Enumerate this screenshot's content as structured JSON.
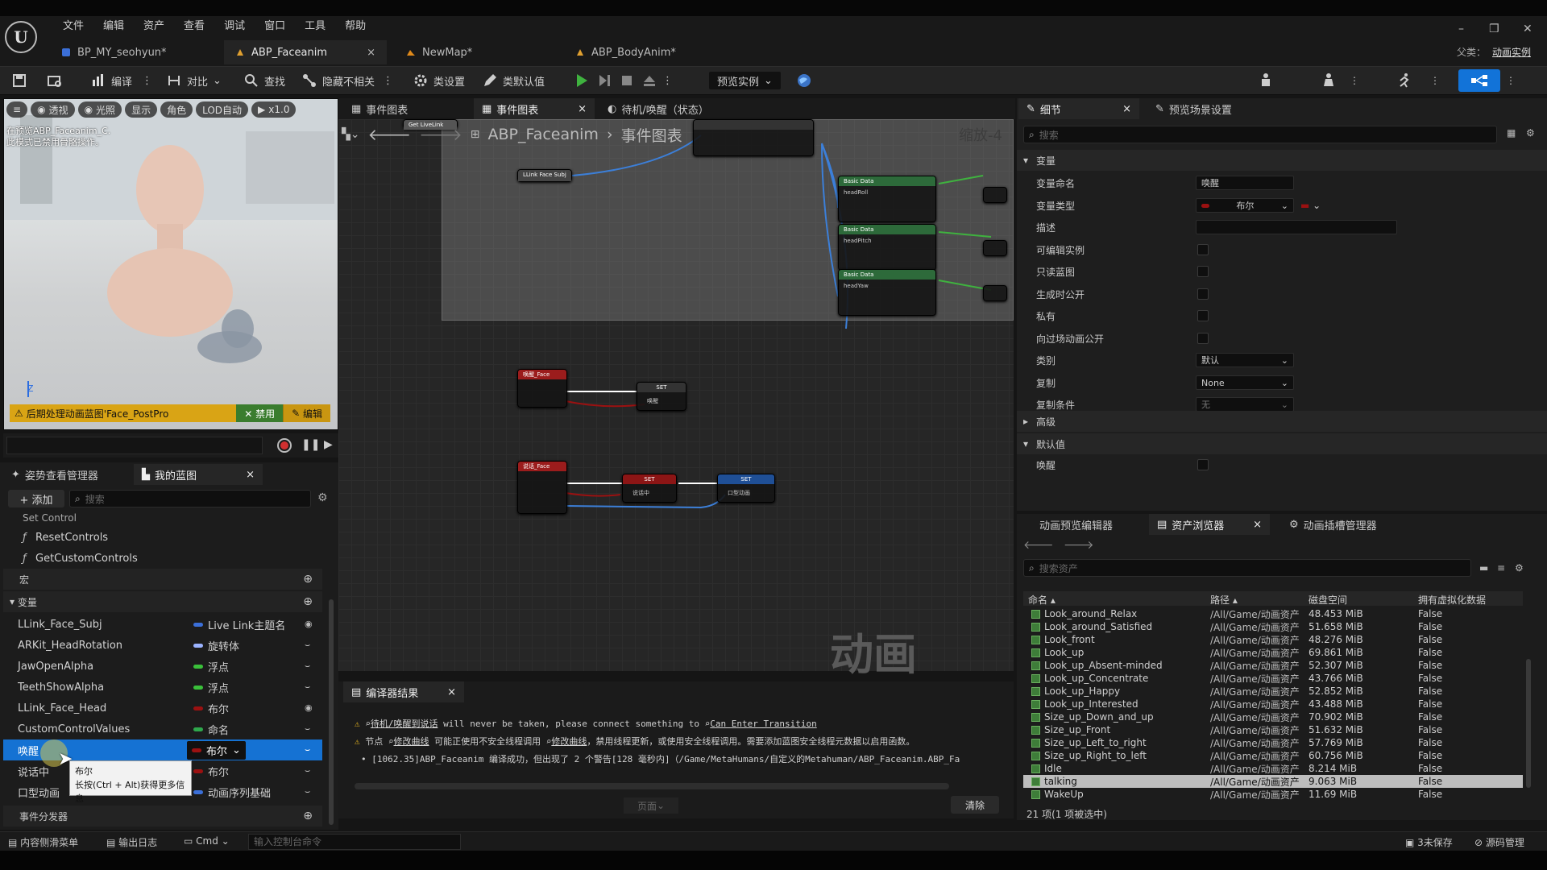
{
  "menu": [
    "文件",
    "编辑",
    "资产",
    "查看",
    "调试",
    "窗口",
    "工具",
    "帮助"
  ],
  "doc_tabs": [
    {
      "label": "BP_MY_seohyun*"
    },
    {
      "label": "ABP_Faceanim"
    },
    {
      "label": "NewMap*"
    },
    {
      "label": "ABP_BodyAnim*"
    }
  ],
  "tab_close": "×",
  "window_controls": {
    "min": "–",
    "max": "❐",
    "close": "✕"
  },
  "parent_class": {
    "label": "父类：",
    "value": "动画实例"
  },
  "toolbar": {
    "compile": "编译",
    "diff": "对比",
    "find": "查找",
    "hide_unrelated": "隐藏不相关",
    "class_settings": "类设置",
    "class_defaults": "类默认值",
    "preview_instance": "预览实例"
  },
  "viewport": {
    "buttons": [
      "透视",
      "光照",
      "显示",
      "角色",
      "LOD自动",
      "x1.0"
    ],
    "info_line1": "在预览ABP_Faceanim_C.",
    "info_line2": "此模式已禁用骨骼操作。",
    "axis_z": "Z",
    "warning": "后期处理动画蓝图'Face_PostPro",
    "disable_btn": "✕ 禁用",
    "edit_btn": "编辑"
  },
  "left_tabs": {
    "pose_manager": "姿势查看管理器",
    "my_blueprint": "我的蓝图"
  },
  "add_button": "+ 添加",
  "search_placeholder": "搜索",
  "functions": [
    "Set Control",
    "ResetControls",
    "GetCustomControls"
  ],
  "sections": {
    "macros": "宏",
    "variables": "变量",
    "dispatchers": "事件分发器"
  },
  "variables": [
    {
      "name": "LLink_Face_Subj",
      "type": "Live Link主题名",
      "color": "#3b6fd8"
    },
    {
      "name": "ARKit_HeadRotation",
      "type": "旋转体",
      "color": "#9bb3ff"
    },
    {
      "name": "JawOpenAlpha",
      "type": "浮点",
      "color": "#3ac03a"
    },
    {
      "name": "TeethShowAlpha",
      "type": "浮点",
      "color": "#3ac03a"
    },
    {
      "name": "LLink_Face_Head",
      "type": "布尔",
      "color": "#9b1111"
    },
    {
      "name": "CustomControlValues",
      "type": "命名",
      "color": "#2fa84c"
    },
    {
      "name": "唤醒",
      "type": "布尔",
      "color": "#9b1111"
    },
    {
      "name": "说话中",
      "type": "布尔",
      "color": "#9b1111"
    },
    {
      "name": "口型动画",
      "type": "动画序列基础",
      "color": "#3b6fd8"
    }
  ],
  "tooltip": {
    "title": "布尔",
    "hint": "长按(Ctrl + Alt)获得更多信息"
  },
  "graph": {
    "tabs": [
      "事件图表",
      "事件图表",
      "待机/唤醒（状态）"
    ],
    "breadcrumb_root": "ABP_Faceanim",
    "breadcrumb_child": "事件图表",
    "zoom": "缩放-4",
    "watermark": "动画",
    "nodes": {
      "get1": "Get LiveLink",
      "get2": "LLink Face Subj",
      "sd": "Property Name",
      "rv": "Return Value",
      "bd": "Basic Data",
      "val": "Value",
      "headroll": "headRoll",
      "headpitch": "headPitch",
      "headyaw": "headYaw",
      "wake_event": "唤醒_Face",
      "custom_event": "自定义事件",
      "set": "SET",
      "wake": "唤醒",
      "talk_event": "说话_Face",
      "talking": "说话中",
      "lip": "口型动画"
    }
  },
  "compiler": {
    "tab": "编译器结果",
    "line1_pre": "待机/唤醒到说话",
    "line1_mid": " will never be taken, please connect something to ",
    "line1_link": "Can Enter Transition",
    "line2_pre": "节点 ",
    "line2_link1": "修改曲线",
    "line2_mid": " 可能正使用不安全线程调用 ",
    "line2_link2": "修改曲线",
    "line2_post": "，禁用线程更新，或使用安全线程调用。需要添加蓝图安全线程元数据以启用函数。",
    "line3": "[1062.35]ABP_Faceanim 编译成功，但出现了 2 个警告[128 毫秒内]（/Game/MetaHumans/自定义的Metahuman/ABP_Faceanim.ABP_Fa",
    "page": "页面",
    "clear": "清除"
  },
  "details": {
    "tab": "细节",
    "tab2": "预览场景设置",
    "search_placeholder": "搜索",
    "section_variable": "变量",
    "section_advanced": "高级",
    "section_default": "默认值",
    "rows": [
      {
        "k": "变量命名",
        "v": "唤醒"
      },
      {
        "k": "变量类型",
        "v": "布尔"
      },
      {
        "k": "描述",
        "v": ""
      },
      {
        "k": "可编辑实例"
      },
      {
        "k": "只读蓝图"
      },
      {
        "k": "生成时公开"
      },
      {
        "k": "私有"
      },
      {
        "k": "向过场动画公开"
      },
      {
        "k": "类别",
        "v": "默认"
      },
      {
        "k": "复制",
        "v": "None"
      },
      {
        "k": "复制条件",
        "v": "无"
      }
    ],
    "default_wake": "唤醒"
  },
  "assets": {
    "tabs": [
      "动画预览编辑器",
      "资产浏览器",
      "动画插槽管理器"
    ],
    "search_placeholder": "搜索资产",
    "columns": [
      "命名",
      "路径",
      "磁盘空间",
      "拥有虚拟化数据"
    ],
    "rows": [
      {
        "n": "Look_around_Relax",
        "p": "/All/Game/动画资产",
        "s": "48.453 MiB",
        "v": "False"
      },
      {
        "n": "Look_around_Satisfied",
        "p": "/All/Game/动画资产",
        "s": "51.658 MiB",
        "v": "False"
      },
      {
        "n": "Look_front",
        "p": "/All/Game/动画资产",
        "s": "48.276 MiB",
        "v": "False"
      },
      {
        "n": "Look_up",
        "p": "/All/Game/动画资产",
        "s": "69.861 MiB",
        "v": "False"
      },
      {
        "n": "Look_up_Absent-minded",
        "p": "/All/Game/动画资产",
        "s": "52.307 MiB",
        "v": "False"
      },
      {
        "n": "Look_up_Concentrate",
        "p": "/All/Game/动画资产",
        "s": "43.766 MiB",
        "v": "False"
      },
      {
        "n": "Look_up_Happy",
        "p": "/All/Game/动画资产",
        "s": "52.852 MiB",
        "v": "False"
      },
      {
        "n": "Look_up_Interested",
        "p": "/All/Game/动画资产",
        "s": "43.488 MiB",
        "v": "False"
      },
      {
        "n": "Size_up_Down_and_up",
        "p": "/All/Game/动画资产",
        "s": "70.902 MiB",
        "v": "False"
      },
      {
        "n": "Size_up_Front",
        "p": "/All/Game/动画资产",
        "s": "51.632 MiB",
        "v": "False"
      },
      {
        "n": "Size_up_Left_to_right",
        "p": "/All/Game/动画资产",
        "s": "57.769 MiB",
        "v": "False"
      },
      {
        "n": "Size_up_Right_to_left",
        "p": "/All/Game/动画资产",
        "s": "60.756 MiB",
        "v": "False"
      },
      {
        "n": "Idle",
        "p": "/All/Game/动画资产",
        "s": "8.214 MiB",
        "v": "False"
      },
      {
        "n": "talking",
        "p": "/All/Game/动画资产",
        "s": "9.063 MiB",
        "v": "False"
      },
      {
        "n": "WakeUp",
        "p": "/All/Game/动画资产",
        "s": "11.69 MiB",
        "v": "False"
      }
    ],
    "selected": "talking",
    "count": "21 项(1 项被选中)"
  },
  "status": {
    "drawer": "内容侧滑菜单",
    "log": "输出日志",
    "cmd": "Cmd",
    "console_placeholder": "输入控制台命令",
    "unsaved": "3未保存",
    "source": "源码管理"
  }
}
